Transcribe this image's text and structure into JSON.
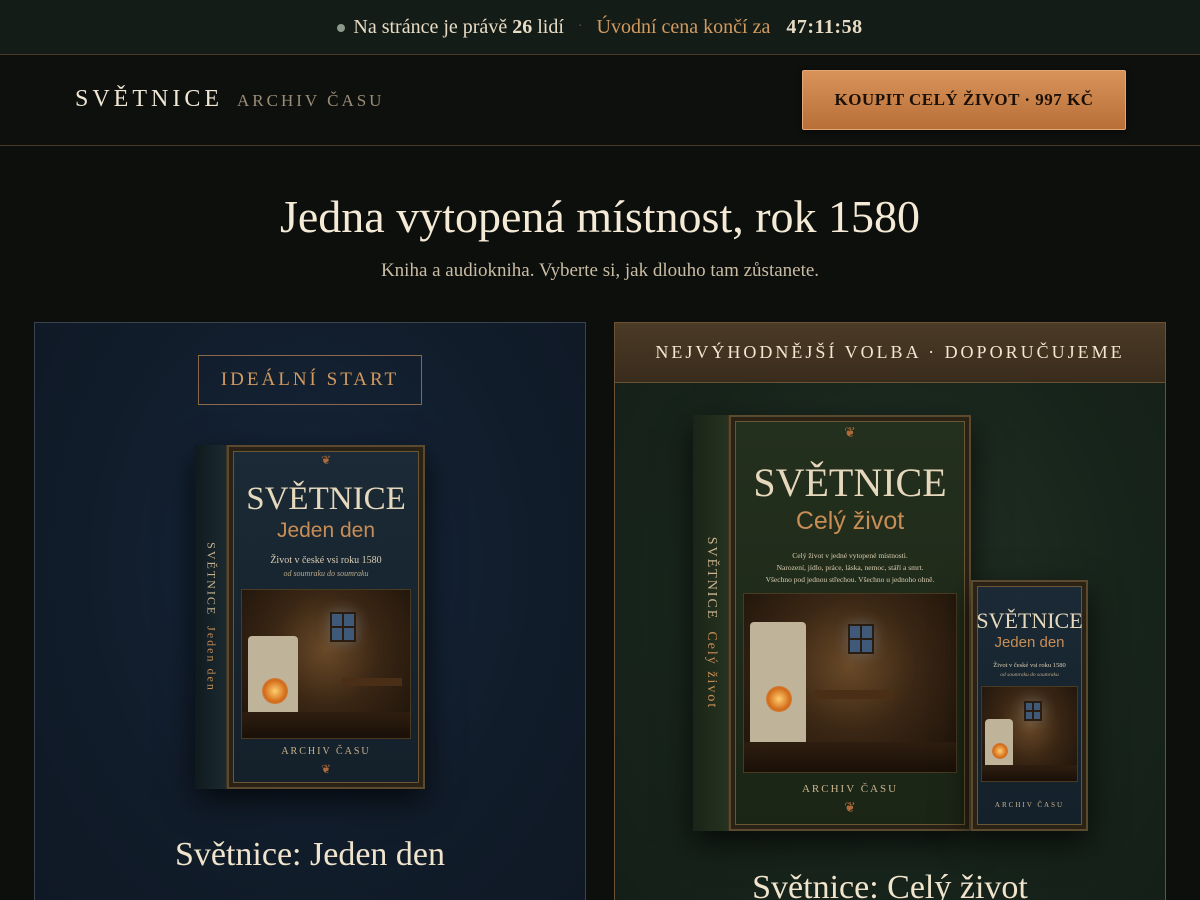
{
  "topbar": {
    "viewers_prefix": "Na stránce je právě",
    "viewers_count": "26",
    "viewers_suffix": "lidí",
    "separator": "·",
    "offer_text": "Úvodní cena končí za",
    "countdown": "47:11:58"
  },
  "header": {
    "brand_name": "SVĚTNICE",
    "brand_subtitle": "ARCHIV ČASU",
    "buy_button_label": "KOUPIT CELÝ ŽIVOT · 997 KČ"
  },
  "hero": {
    "title": "Jedna vytopená místnost, rok 1580",
    "subtitle": "Kniha a audiokniha. Vyberte si, jak dlouho tam zůstanete."
  },
  "products": [
    {
      "badge": "IDEÁLNÍ START",
      "title": "Světnice: Jeden den",
      "cover": {
        "title": "SVĚTNICE",
        "subtitle": "Jeden den",
        "tagline": "Život v české vsi roku 1580",
        "tagline2": "od soumraku do soumraku",
        "spine_title": "SVĚTNICE",
        "spine_subtitle": "Jeden den",
        "publisher": "ARCHIV ČASU"
      }
    },
    {
      "badge": "NEJVÝHODNĚJŠÍ VOLBA · DOPORUČUJEME",
      "title": "Světnice: Celý život",
      "cover": {
        "title": "SVĚTNICE",
        "subtitle": "Celý život",
        "line1": "Celý život v jedné vytopené místnosti.",
        "line2": "Narození, jídlo, práce, láska, nemoc, stáří a smrt.",
        "line3": "Všechno pod jednou střechou. Všechno u jednoho ohně.",
        "spine_title": "SVĚTNICE",
        "spine_subtitle": "Celý život",
        "publisher": "ARCHIV ČASU"
      },
      "bundled_cover": {
        "title": "SVĚTNICE",
        "subtitle": "Jeden den",
        "tagline": "Život v české vsi roku 1580",
        "tagline2": "od soumraku do soumraku",
        "publisher": "ARCHIV ČASU"
      }
    }
  ],
  "colors": {
    "accent": "#d19a5f",
    "button": "#c9824a",
    "background": "#0d0f0d",
    "card_left": "#13202f",
    "card_right": "#1b2a20"
  }
}
